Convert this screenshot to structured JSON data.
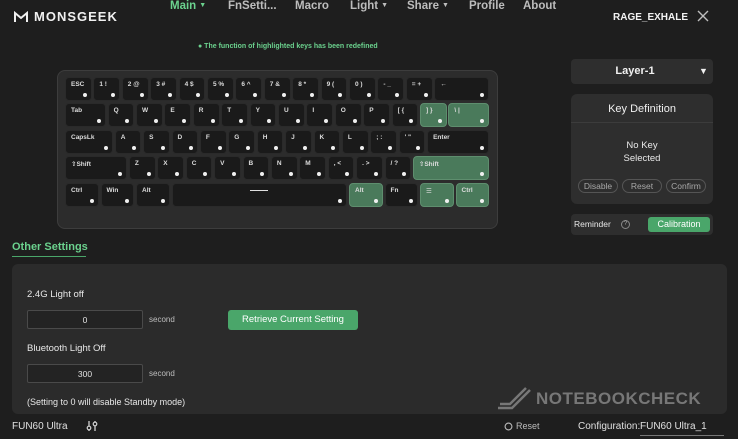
{
  "brand": {
    "name": "MONSGEEK"
  },
  "nav": {
    "items": [
      {
        "label": "Main",
        "active": true,
        "dropdown": true
      },
      {
        "label": "FnSetti...",
        "active": false,
        "dropdown": false
      },
      {
        "label": "Macro",
        "active": false,
        "dropdown": false
      },
      {
        "label": "Light",
        "active": false,
        "dropdown": true
      },
      {
        "label": "Share",
        "active": false,
        "dropdown": true
      },
      {
        "label": "Profile",
        "active": false,
        "dropdown": false
      },
      {
        "label": "About",
        "active": false,
        "dropdown": false
      }
    ],
    "user": "RAGE_EXHALE",
    "close_icon": "close-icon"
  },
  "notice": "● The function of highlighted keys has been redefined",
  "keyboard": {
    "highlight_color": "#4a7a5b",
    "rows": [
      [
        {
          "l": "ESC"
        },
        {
          "l": "1 !"
        },
        {
          "l": "2 @"
        },
        {
          "l": "3 #"
        },
        {
          "l": "4 $"
        },
        {
          "l": "5 %"
        },
        {
          "l": "6 ^"
        },
        {
          "l": "7 &"
        },
        {
          "l": "8 *"
        },
        {
          "l": "9 ("
        },
        {
          "l": "0 )"
        },
        {
          "l": "- _"
        },
        {
          "l": "= +"
        },
        {
          "l": "←"
        }
      ],
      [
        {
          "l": "Tab"
        },
        {
          "l": "Q"
        },
        {
          "l": "W"
        },
        {
          "l": "E"
        },
        {
          "l": "R"
        },
        {
          "l": "T"
        },
        {
          "l": "Y"
        },
        {
          "l": "U"
        },
        {
          "l": "I"
        },
        {
          "l": "O"
        },
        {
          "l": "P"
        },
        {
          "l": "[ {"
        },
        {
          "l": "] }",
          "hl": true
        },
        {
          "l": "\\ |",
          "hl": true
        }
      ],
      [
        {
          "l": "CapsLk"
        },
        {
          "l": "A"
        },
        {
          "l": "S"
        },
        {
          "l": "D"
        },
        {
          "l": "F"
        },
        {
          "l": "G"
        },
        {
          "l": "H"
        },
        {
          "l": "J"
        },
        {
          "l": "K"
        },
        {
          "l": "L"
        },
        {
          "l": "; :"
        },
        {
          "l": "' \""
        },
        {
          "l": "Enter"
        }
      ],
      [
        {
          "l": "⇧Shift"
        },
        {
          "l": "Z"
        },
        {
          "l": "X"
        },
        {
          "l": "C"
        },
        {
          "l": "V"
        },
        {
          "l": "B"
        },
        {
          "l": "N"
        },
        {
          "l": "M"
        },
        {
          "l": ", <"
        },
        {
          "l": ". >"
        },
        {
          "l": "/ ?"
        },
        {
          "l": "⇧Shift",
          "hl": true
        }
      ],
      [
        {
          "l": "Ctrl"
        },
        {
          "l": "Win"
        },
        {
          "l": "Alt"
        },
        {
          "l": "",
          "space": true
        },
        {
          "l": "Alt",
          "hl": true
        },
        {
          "l": "Fn"
        },
        {
          "l": "☰",
          "hl": true
        },
        {
          "l": "Ctrl",
          "hl": true
        }
      ]
    ]
  },
  "layer": {
    "selected": "Layer-1"
  },
  "key_definition": {
    "title": "Key Definition",
    "status_line1": "No Key",
    "status_line2": "Selected",
    "buttons": {
      "disable": "Disable",
      "reset": "Reset",
      "confirm": "Confirm"
    }
  },
  "reminder": {
    "label": "Reminder",
    "calibration": "Calibration"
  },
  "other_settings": {
    "title": "Other Settings",
    "light_24g_label": "2.4G Light off",
    "light_24g_value": "0",
    "unit": "second",
    "retrieve_button": "Retrieve Current Setting",
    "bluetooth_label": "Bluetooth Light Off",
    "bluetooth_value": "300",
    "standby_note": "(Setting to 0 will disable Standby mode)"
  },
  "footer": {
    "device": "FUN60 Ultra",
    "reset": "Reset",
    "config_label": "Configuration:",
    "config_value": "FUN60 Ultra_1"
  },
  "watermark": "NOTEBOOKCHECK",
  "colors": {
    "accent": "#6bd28e",
    "button_green": "#4aa66a",
    "background": "#1e1e1e"
  }
}
